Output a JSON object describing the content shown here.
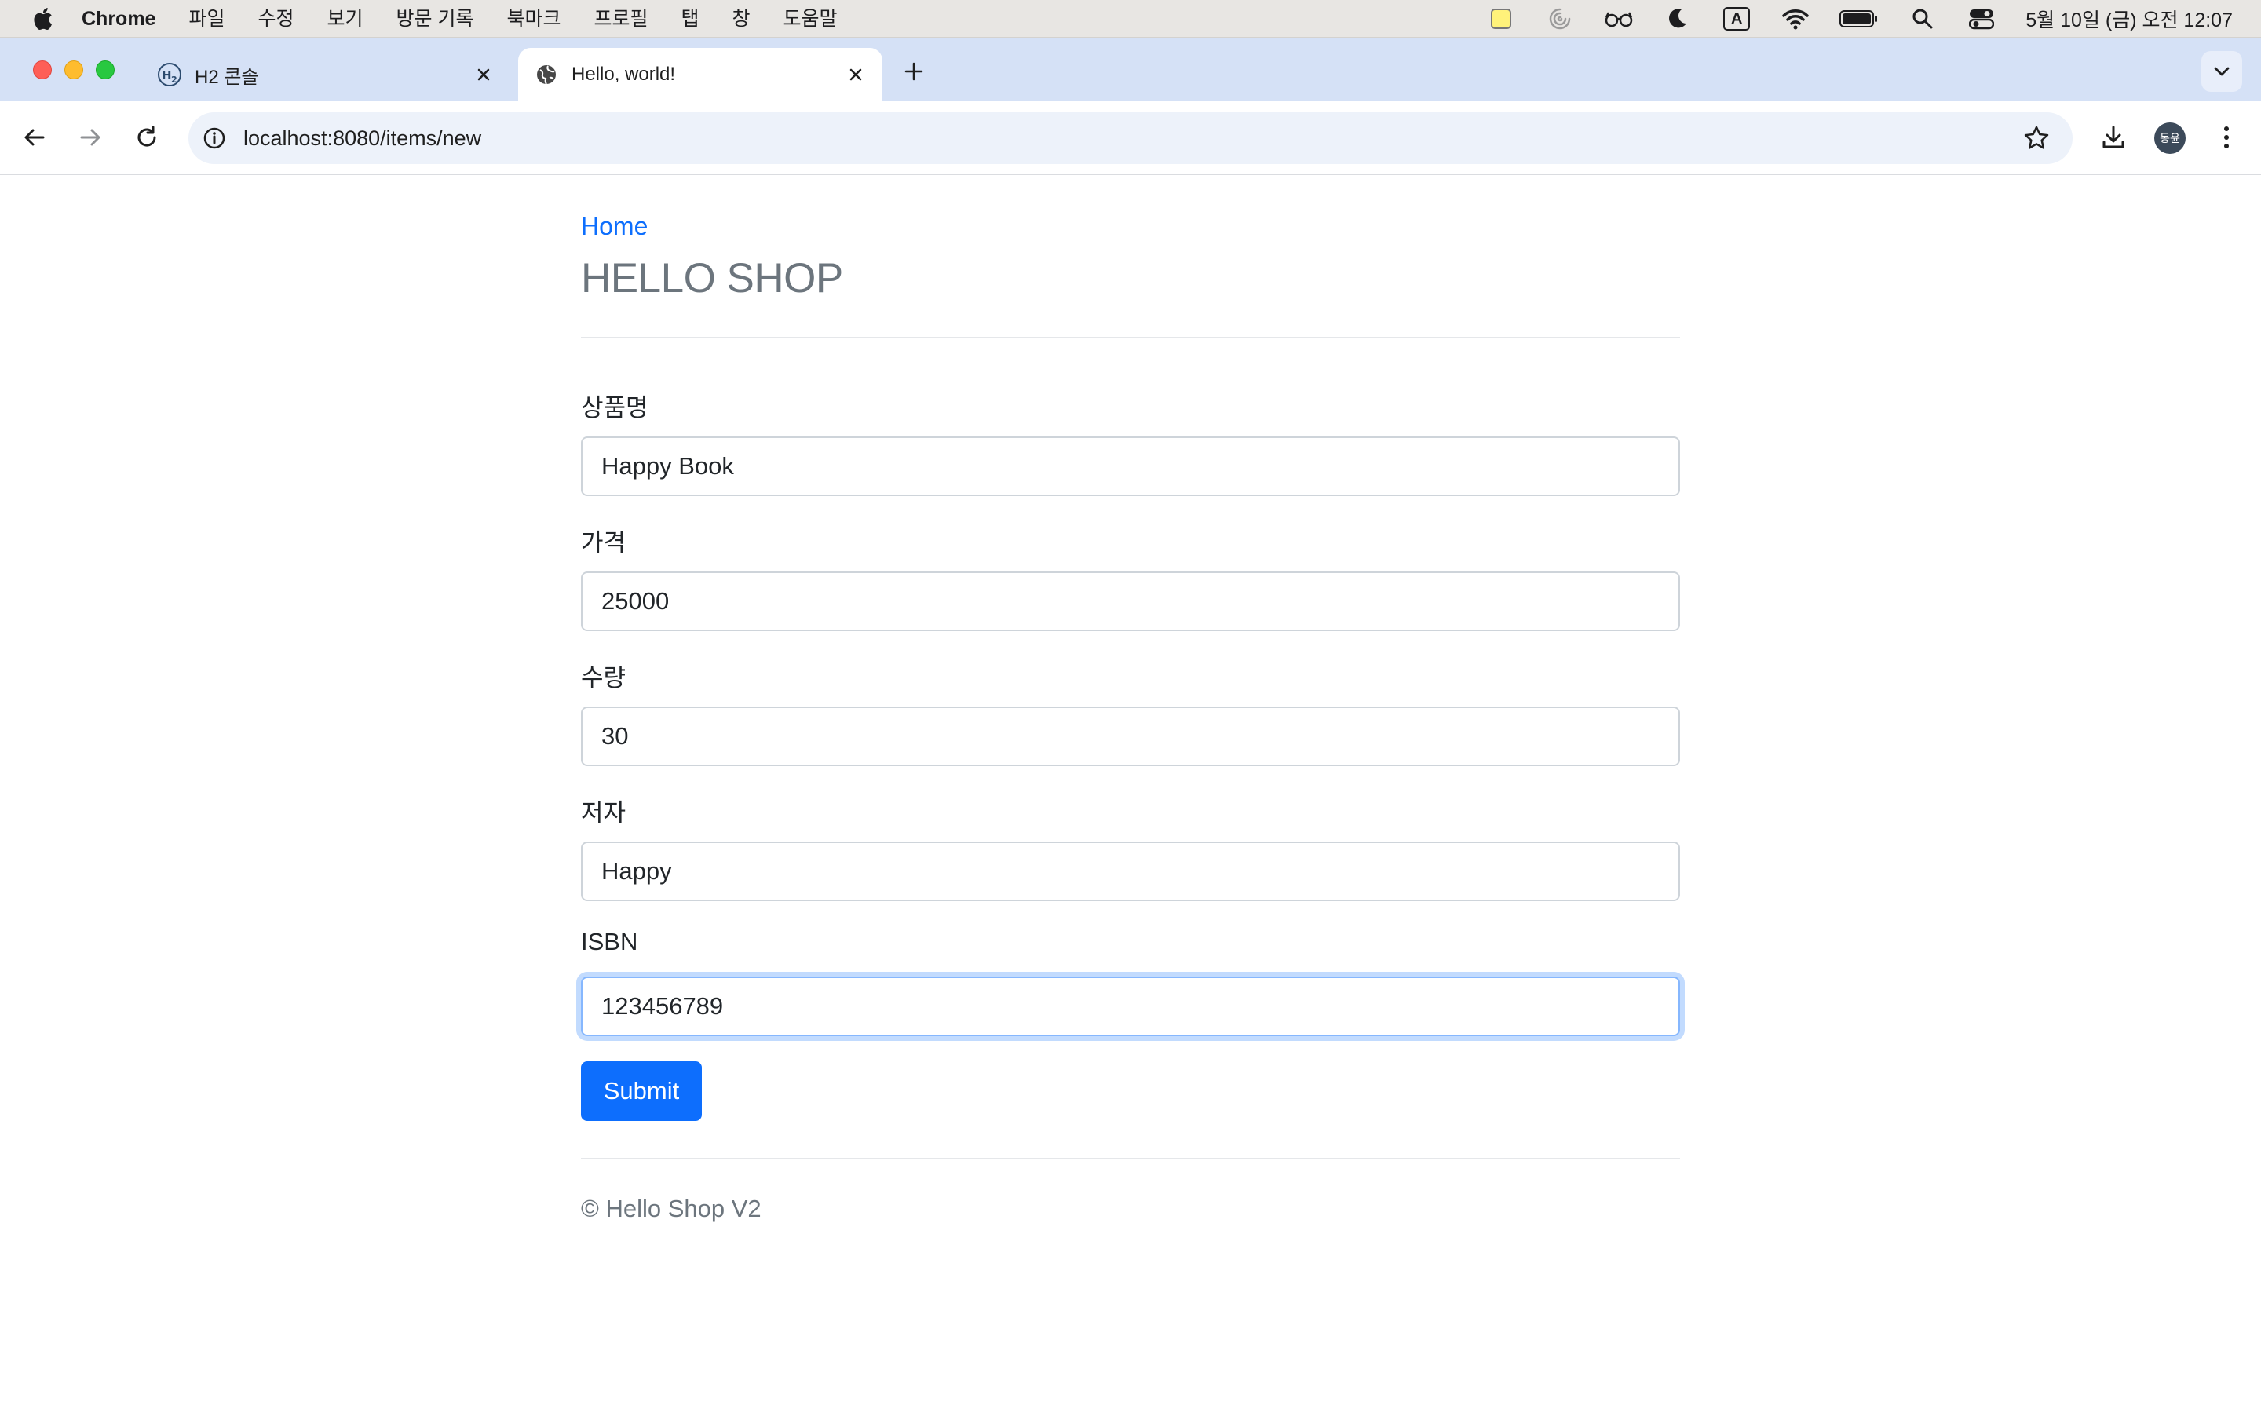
{
  "menubar": {
    "app_name": "Chrome",
    "items": [
      "파일",
      "수정",
      "보기",
      "방문 기록",
      "북마크",
      "프로필",
      "탭",
      "창",
      "도움말"
    ],
    "clock": "5월 10일 (금) 오전 12:07",
    "input_indicator": "A"
  },
  "tabs": [
    {
      "title": "H2 콘솔",
      "favicon": "h2-icon",
      "active": false
    },
    {
      "title": "Hello, world!",
      "favicon": "globe-icon",
      "active": true
    }
  ],
  "toolbar": {
    "url": "localhost:8080/items/new",
    "avatar_text": "동윤"
  },
  "page": {
    "home_link": "Home",
    "title": "HELLO SHOP",
    "form": {
      "fields": [
        {
          "label": "상품명",
          "value": "Happy Book"
        },
        {
          "label": "가격",
          "value": "25000"
        },
        {
          "label": "수량",
          "value": "30"
        },
        {
          "label": "저자",
          "value": "Happy"
        },
        {
          "label": "ISBN",
          "value": "123456789"
        }
      ],
      "submit_label": "Submit"
    },
    "footer": "© Hello Shop V2"
  },
  "colors": {
    "primary": "#0d6efd",
    "muted": "#6c757d",
    "tabstrip": "#d5e1f6",
    "focus_border": "#86b7fe"
  }
}
